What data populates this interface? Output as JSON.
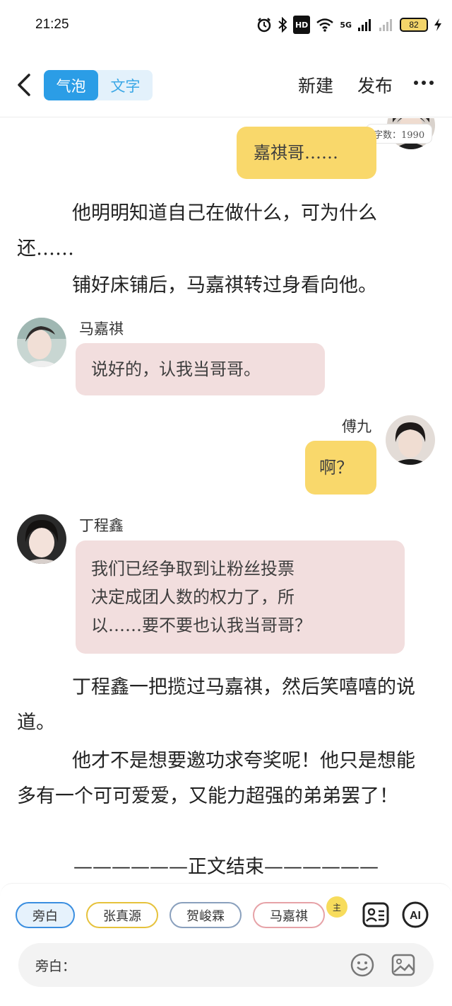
{
  "status_bar": {
    "time": "21:25",
    "hd_label": "HD",
    "network_label": "5G",
    "battery_level": "82",
    "icons": [
      "alarm-icon",
      "bluetooth-icon",
      "hd-icon",
      "wifi-icon",
      "signal-icon",
      "battery-icon",
      "charging-icon"
    ]
  },
  "header": {
    "mode_bubble": "气泡",
    "mode_text": "文字",
    "active_mode": "气泡",
    "new_label": "新建",
    "publish_label": "发布",
    "accent_color": "#2b9de6"
  },
  "chat": {
    "word_count": "字数：1990",
    "messages": [
      {
        "side": "right",
        "color": "yellow",
        "text": "嘉祺哥……"
      },
      {
        "type": "narration",
        "text": "他明明知道自己在做什么，可为什么还……"
      },
      {
        "type": "narration",
        "text": "铺好床铺后，马嘉祺转过身看向他。"
      },
      {
        "side": "left",
        "name": "马嘉祺",
        "color": "pink",
        "text": "说好的，认我当哥哥。"
      },
      {
        "side": "right",
        "name": "傅九",
        "color": "yellow",
        "text": "啊？"
      },
      {
        "side": "left",
        "name": "丁程鑫",
        "color": "pink",
        "lines": [
          "我们已经争取到让粉丝投票",
          "决定成团人数的权力了，所",
          "以……要不要也认我当哥哥？"
        ]
      },
      {
        "type": "narration",
        "text": "丁程鑫一把揽过马嘉祺，然后笑嘻嘻的说道。"
      },
      {
        "type": "narration",
        "text": "他才不是想要邀功求夸奖呢！他只是想能多有一个可可爱爱，又能力超强的弟弟罢了！"
      },
      {
        "type": "end",
        "text": "——————正文结束——————"
      }
    ]
  },
  "bottom_bar": {
    "roles": [
      "旁白",
      "张真源",
      "贺峻霖",
      "马嘉祺"
    ],
    "main_badge": "主",
    "ai_label": "AI",
    "input_prefix": "旁白：",
    "input_value": ""
  }
}
